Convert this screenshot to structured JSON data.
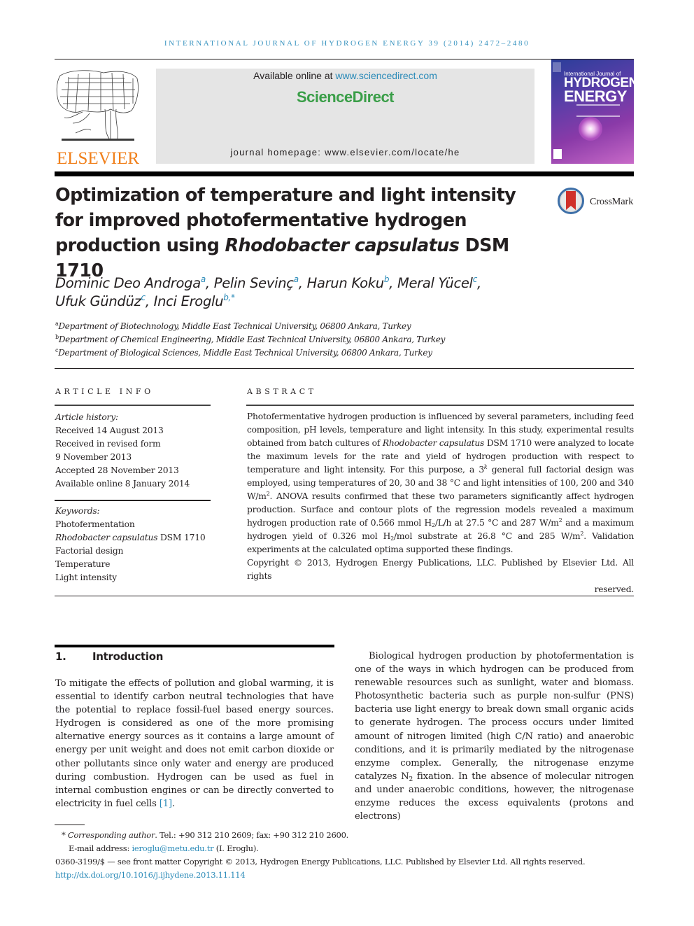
{
  "running_head": "INTERNATIONAL JOURNAL OF HYDROGEN ENERGY 39 (2014) 2472–2480",
  "masthead": {
    "publisher_logo_text": "ELSEVIER",
    "available_online_prefix": "Available online at ",
    "available_online_link": "www.sciencedirect.com",
    "brand": "ScienceDirect",
    "homepage": "journal homepage: www.elsevier.com/locate/he",
    "cover": {
      "line1": "International Journal of",
      "line2": "HYDROGEN",
      "line3": "ENERGY"
    },
    "colors": {
      "elsevier_orange": "#f07f1a",
      "sciencedirect_green": "#3a9e48",
      "link_blue": "#2a8ab8"
    }
  },
  "article": {
    "title_part1": "Optimization of temperature and light intensity for improved photofermentative hydrogen production using ",
    "title_italic": "Rhodobacter capsulatus",
    "title_part2": " DSM 1710",
    "crossmark_label": "CrossMark",
    "authors": [
      {
        "name": "Dominic Deo Androga",
        "sup": "a",
        "sep": ", "
      },
      {
        "name": "Pelin Sevinç",
        "sup": "a",
        "sep": ", "
      },
      {
        "name": "Harun Koku",
        "sup": "b",
        "sep": ", "
      },
      {
        "name": "Meral Yücel",
        "sup": "c",
        "sep": ","
      },
      {
        "name": "Ufuk Gündüz",
        "sup": "c",
        "sep": ", "
      },
      {
        "name": "Inci Eroglu",
        "sup": "b,*",
        "sep": ""
      }
    ],
    "affiliations": [
      {
        "key": "a",
        "text": "Department of Biotechnology, Middle East Technical University, 06800 Ankara, Turkey"
      },
      {
        "key": "b",
        "text": "Department of Chemical Engineering, Middle East Technical University, 06800 Ankara, Turkey"
      },
      {
        "key": "c",
        "text": "Department of Biological Sciences, Middle East Technical University, 06800 Ankara, Turkey"
      }
    ]
  },
  "article_info": {
    "heading": "ARTICLE INFO",
    "history_label": "Article history:",
    "history": [
      "Received 14 August 2013",
      "Received in revised form",
      "9 November 2013",
      "Accepted 28 November 2013",
      "Available online 8 January 2014"
    ],
    "keywords_label": "Keywords:",
    "keywords": [
      "Photofermentation",
      "Factorial design",
      "Temperature",
      "Light intensity"
    ],
    "keyword_species_italic": "Rhodobacter capsulatus",
    "keyword_species_rest": " DSM 1710"
  },
  "abstract": {
    "heading": "ABSTRACT",
    "t1": "Photofermentative hydrogen production is influenced by several parameters, including feed composition, pH levels, temperature and light intensity. In this study, experimental results obtained from batch cultures of ",
    "t1_italic": "Rhodobacter capsulatus",
    "t2": " DSM 1710 were analyzed to locate the maximum levels for the rate and yield of hydrogen production with respect to temperature and light intensity. For this purpose, a 3",
    "t2_sup": "k",
    "t3": " general full factorial design was employed, using temperatures of 20, 30 and 38 °C and light intensities of 100, 200 and 340 W/m",
    "t3_sup": "2",
    "t4": ". ANOVA results confirmed that these two parameters significantly affect hydrogen production. Surface and contour plots of the regression models revealed a maximum hydrogen production rate of 0.566 mmol H",
    "t4_sub": "2",
    "t5": "/L/h at 27.5 °C and 287 W/m",
    "t5_sup": "2",
    "t6": " and a maximum hydrogen yield of 0.326 mol H",
    "t6_sub": "2",
    "t7": "/mol substrate at 26.8 °C and 285 W/m",
    "t7_sup": "2",
    "t8": ". Validation experiments at the calculated optima supported these findings.",
    "copyright": "Copyright © 2013, Hydrogen Energy Publications, LLC. Published by Elsevier Ltd. All rights",
    "copyright_end": "reserved."
  },
  "introduction": {
    "number": "1.",
    "heading": "Introduction",
    "left_text": "To mitigate the effects of pollution and global warming, it is essential to identify carbon neutral technologies that have the potential to replace fossil-fuel based energy sources. Hydrogen is considered as one of the more promising alternative energy sources as it contains a large amount of energy per unit weight and does not emit carbon dioxide or other pollutants since only water and energy are produced during combustion. Hydrogen can be used as fuel in internal combustion engines or can be directly converted to electricity in fuel cells ",
    "left_ref": "[1]",
    "left_end": ".",
    "right_text1": "Biological hydrogen production by photofermentation is one of the ways in which hydrogen can be produced from renewable resources such as sunlight, water and biomass. Photosynthetic bacteria such as purple non-sulfur (PNS) bacteria use light energy to break down small organic acids to generate hydrogen. The process occurs under limited amount of nitrogen limited (high C/N ratio) and anaerobic conditions, and it is primarily mediated by the nitrogenase enzyme complex. Generally, the nitrogenase enzyme catalyzes N",
    "right_sub": "2",
    "right_text2": " fixation. In the absence of molecular nitrogen and under anaerobic conditions, however, the nitrogenase enzyme reduces the excess equivalents (protons and electrons)"
  },
  "footnotes": {
    "star": "*",
    "corr_label": "Corresponding author",
    "corr_rest": ". Tel.: +90 312 210 2609; fax: +90 312 210 2600.",
    "email_label": "E-mail address: ",
    "email": "ieroglu@metu.edu.tr",
    "email_after": " (I. Eroglu).",
    "issn_line": "0360-3199/$ — see front matter Copyright © 2013, Hydrogen Energy Publications, LLC. Published by Elsevier Ltd. All rights reserved.",
    "doi": "http://dx.doi.org/10.1016/j.ijhydene.2013.11.114"
  }
}
